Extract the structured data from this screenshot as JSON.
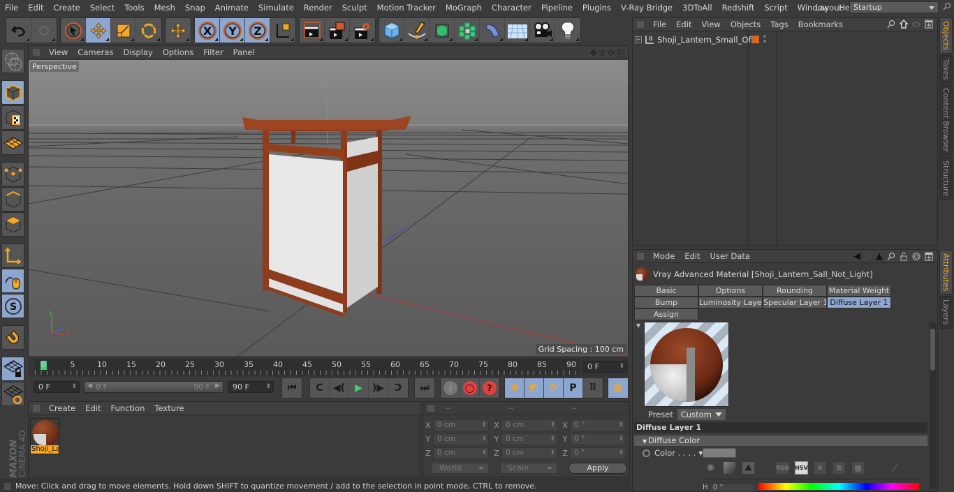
{
  "app": {
    "name": "Cinema 4D",
    "brand_line1": "MAXON",
    "brand_line2": "CINEMA 4D"
  },
  "menubar": {
    "items": [
      "File",
      "Edit",
      "Create",
      "Select",
      "Tools",
      "Mesh",
      "Snap",
      "Animate",
      "Simulate",
      "Render",
      "Sculpt",
      "Motion Tracker",
      "MoGraph",
      "Character",
      "Pipeline",
      "Plugins",
      "V-Ray Bridge",
      "3DToAll",
      "Redshift",
      "Script",
      "Window",
      "Help"
    ],
    "layout_label": "Layout:",
    "layout_value": "Startup"
  },
  "toolbar": {
    "groups": [
      [
        {
          "icon": "undo-icon"
        },
        {
          "icon": "redo-icon",
          "disabled": true
        }
      ],
      [
        {
          "icon": "live-selection-icon"
        },
        {
          "icon": "move-icon",
          "active": true
        },
        {
          "icon": "scale-icon"
        },
        {
          "icon": "rotate-icon"
        }
      ],
      [
        {
          "icon": "recent-tool-icon"
        }
      ],
      [
        {
          "icon": "x-axis-lock-icon",
          "label": "X",
          "active": true
        },
        {
          "icon": "y-axis-lock-icon",
          "label": "Y",
          "active": true
        },
        {
          "icon": "z-axis-lock-icon",
          "label": "Z",
          "active": true
        },
        {
          "icon": "coordinate-system-icon"
        }
      ],
      [
        {
          "icon": "render-view-icon"
        },
        {
          "icon": "render-picture-viewer-icon"
        },
        {
          "icon": "render-settings-icon"
        }
      ],
      [
        {
          "icon": "cube-icon"
        },
        {
          "icon": "pen-spline-icon"
        },
        {
          "icon": "subdivision-icon"
        },
        {
          "icon": "cloner-icon"
        },
        {
          "icon": "deformer-bend-icon"
        },
        {
          "icon": "floor-icon"
        },
        {
          "icon": "camera-icon"
        },
        {
          "icon": "light-icon"
        }
      ]
    ]
  },
  "left_toolbar": {
    "items": [
      {
        "icon": "make-editable-icon"
      },
      {
        "icon": "model-mode-icon",
        "active": true
      },
      {
        "icon": "texture-mode-icon"
      },
      {
        "icon": "workplane-mode-icon"
      },
      {
        "icon": "points-mode-icon"
      },
      {
        "icon": "edges-mode-icon"
      },
      {
        "icon": "polygons-mode-icon"
      },
      {
        "icon": "enable-axis-icon"
      },
      {
        "icon": "tweak-mode-icon",
        "active": true
      },
      {
        "icon": "solo-mode-icon",
        "active": true
      },
      {
        "icon": "snap-icon"
      },
      {
        "icon": "lock-workplane-icon",
        "active": true
      },
      {
        "icon": "planar-workplane-icon"
      }
    ]
  },
  "viewport": {
    "menu": [
      "View",
      "Cameras",
      "Display",
      "Options",
      "Filter",
      "Panel"
    ],
    "camera_label": "Perspective",
    "grid_spacing": "Grid Spacing : 100 cm",
    "axis_labels": {
      "y": "Y",
      "z": "Z",
      "x": "X"
    }
  },
  "timeline": {
    "ticks": [
      "0",
      "5",
      "10",
      "15",
      "20",
      "25",
      "30",
      "35",
      "40",
      "45",
      "50",
      "55",
      "60",
      "65",
      "70",
      "75",
      "80",
      "85",
      "90"
    ],
    "current_frame": 0,
    "current_frame_field": "0 F",
    "start_field": "0 F",
    "range_start": "0 F",
    "range_end": "90 F",
    "end_field": "90 F",
    "max_frame": 90
  },
  "transport": {
    "groups": [
      [
        {
          "icon": "go-to-start-icon",
          "glyph": "⏮"
        }
      ],
      [
        {
          "icon": "previous-key-icon",
          "glyph": "C"
        },
        {
          "icon": "previous-frame-icon",
          "glyph": "◀("
        },
        {
          "icon": "play-icon",
          "glyph": "▶"
        },
        {
          "icon": "next-frame-icon",
          "glyph": ")▶"
        },
        {
          "icon": "next-key-icon",
          "glyph": "Ↄ"
        }
      ],
      [
        {
          "icon": "go-to-end-icon",
          "glyph": "⏭"
        }
      ],
      [
        {
          "icon": "record-keys-icon",
          "glyph": "⚷"
        },
        {
          "icon": "autokeying-icon",
          "glyph": "◯"
        },
        {
          "icon": "keyframe-selection-icon",
          "glyph": "?"
        }
      ],
      [
        {
          "icon": "key-position-icon",
          "glyph": "✥",
          "active": true
        },
        {
          "icon": "key-scale-icon",
          "glyph": "◩",
          "active": true
        },
        {
          "icon": "key-rotation-icon",
          "glyph": "⟳",
          "active": true
        },
        {
          "icon": "key-parameter-icon",
          "glyph": "P",
          "active": true
        },
        {
          "icon": "key-point-level-icon",
          "glyph": "⠿"
        }
      ],
      [
        {
          "icon": "timeline-window-icon",
          "glyph": "▦",
          "active": true
        }
      ]
    ]
  },
  "material_manager": {
    "menu": [
      "Create",
      "Edit",
      "Function",
      "Texture"
    ],
    "materials": [
      {
        "name": "Shoji_La",
        "selected": true
      }
    ]
  },
  "coordinates": {
    "headers": [
      "--",
      "--",
      "--"
    ],
    "rows": [
      {
        "axis": "X",
        "pos": "0 cm",
        "size": "0 cm",
        "rot": "0 °"
      },
      {
        "axis": "Y",
        "pos": "0 cm",
        "size": "0 cm",
        "rot": "0 °"
      },
      {
        "axis": "Z",
        "pos": "0 cm",
        "size": "0 cm",
        "rot": "0 °"
      }
    ],
    "space": "World",
    "mode": "Scale",
    "apply_label": "Apply"
  },
  "status": {
    "text": "Move: Click and drag to move elements. Hold down SHIFT to quantize movement / add to the selection in point mode, CTRL to remove."
  },
  "object_manager": {
    "menu": [
      "File",
      "Edit",
      "View",
      "Objects",
      "Tags",
      "Bookmarks"
    ],
    "objects": [
      {
        "name": "Shoji_Lantern_Small_Off",
        "tag_color": "#d2692a"
      }
    ]
  },
  "right_tabs_top": [
    {
      "label": "Objects",
      "active": true
    },
    {
      "label": "Takes"
    },
    {
      "label": "Content Browser"
    },
    {
      "label": "Structure"
    }
  ],
  "right_tabs_bottom": [
    {
      "label": "Attributes",
      "active": true
    },
    {
      "label": "Layers"
    }
  ],
  "attributes": {
    "menu": [
      "Mode",
      "Edit",
      "User Data"
    ],
    "title": "Vray Advanced Material [Shoji_Lantern_Sall_Not_Light]",
    "tabs": [
      {
        "label": "Basic"
      },
      {
        "label": "Options"
      },
      {
        "label": "Rounding"
      },
      {
        "label": "Material Weight"
      },
      {
        "label": "Bump"
      },
      {
        "label": "Luminosity Layer"
      },
      {
        "label": "Specular Layer 1"
      },
      {
        "label": "Diffuse Layer 1",
        "active": true
      },
      {
        "label": "Assign"
      }
    ],
    "preset_label": "Preset",
    "preset_value": "Custom",
    "section_title": "Diffuse Layer 1",
    "group_title": "Diffuse Color",
    "color_label": "Color . . . .",
    "color_value": "#7e7e7e",
    "color_modes": [
      "RGB",
      "HSV",
      "K"
    ],
    "active_color_mode": "HSV",
    "h_label": "H",
    "h_value": "0 °"
  }
}
